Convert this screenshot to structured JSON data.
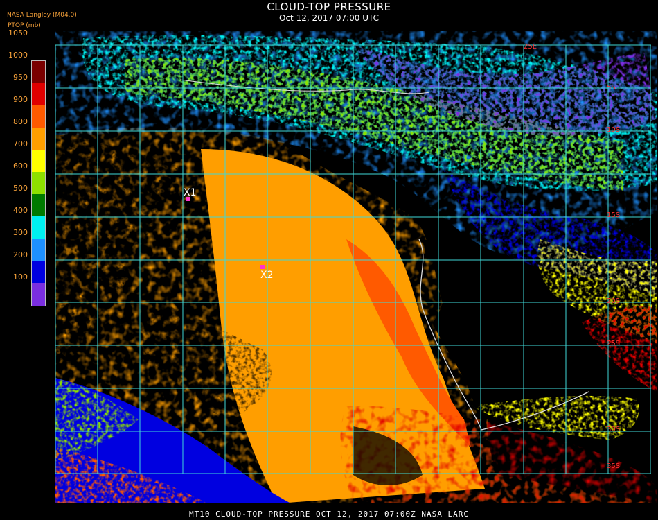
{
  "header": {
    "title": "CLOUD-TOP PRESSURE",
    "subtitle": "Oct 12, 2017 07:00 UTC",
    "source": "NASA Langley (M04.0)",
    "units": "PTOP (mb)"
  },
  "legend": {
    "ticks": [
      "1050",
      "1000",
      "950",
      "900",
      "800",
      "700",
      "600",
      "500",
      "400",
      "300",
      "200",
      "100"
    ],
    "colors": [
      "#7a0000",
      "#e00000",
      "#ff5a00",
      "#ff9e00",
      "#ffff00",
      "#8ee000",
      "#007a00",
      "#00f0f0",
      "#1e90ff",
      "#0000e0",
      "#7a2ee0"
    ]
  },
  "map": {
    "lat_labels": [
      "5S",
      "10S",
      "15S",
      "20S",
      "25S",
      "30S",
      "35S"
    ],
    "lon_labels": [
      "25E"
    ],
    "markers": [
      {
        "label": "X1",
        "color": "#ff33cc"
      },
      {
        "label": "X2",
        "color": "#ff33cc"
      }
    ],
    "grid_color": "#3fd8d8"
  },
  "footer": {
    "text": "MT10  CLOUD-TOP PRESSURE   OCT 12, 2017 07:00Z   NASA LARC"
  }
}
